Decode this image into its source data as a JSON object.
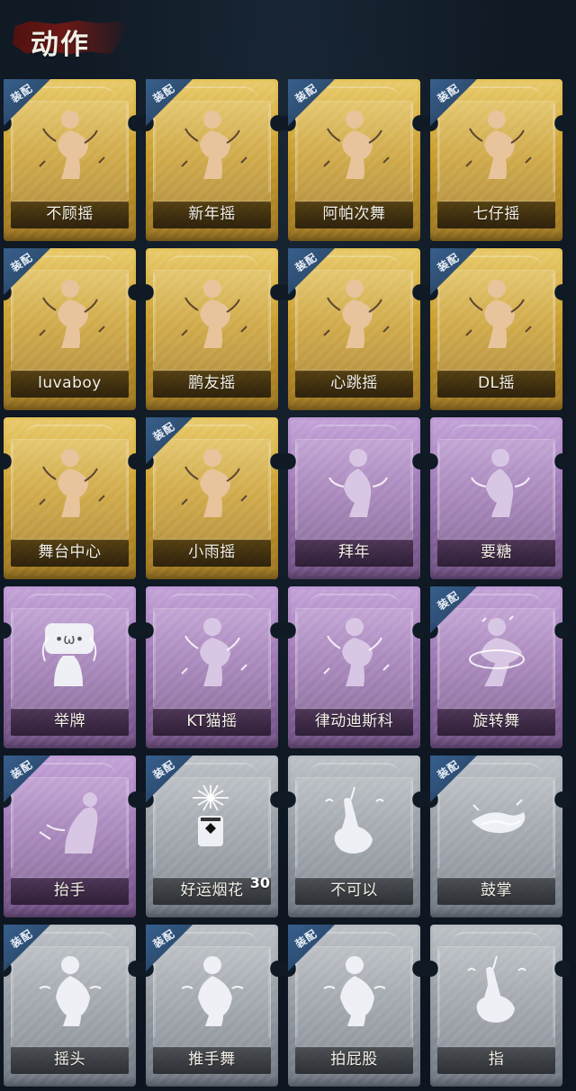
{
  "header": {
    "title": "动作"
  },
  "cards": [
    {
      "label": "不顾摇",
      "variant": "gold",
      "equipped": true,
      "icon": "dance-pose-icon"
    },
    {
      "label": "新年摇",
      "variant": "gold",
      "equipped": true,
      "icon": "dance-pose-icon"
    },
    {
      "label": "阿帕次舞",
      "variant": "gold",
      "equipped": true,
      "icon": "dance-pose-icon"
    },
    {
      "label": "七仔摇",
      "variant": "gold",
      "equipped": true,
      "icon": "dance-pose-icon"
    },
    {
      "label": "luvaboy",
      "variant": "gold",
      "equipped": true,
      "icon": "dance-pose-icon"
    },
    {
      "label": "鹏友摇",
      "variant": "gold",
      "equipped": false,
      "icon": "dance-pose-icon"
    },
    {
      "label": "心跳摇",
      "variant": "gold",
      "equipped": true,
      "icon": "dance-pose-icon"
    },
    {
      "label": "DL摇",
      "variant": "gold",
      "equipped": true,
      "icon": "dance-pose-icon"
    },
    {
      "label": "舞台中心",
      "variant": "gold",
      "equipped": false,
      "icon": "dance-pose-icon"
    },
    {
      "label": "小雨摇",
      "variant": "gold",
      "equipped": true,
      "icon": "dance-pose-icon"
    },
    {
      "label": "拜年",
      "variant": "purple",
      "equipped": false,
      "icon": "greeting-pose-icon"
    },
    {
      "label": "要糖",
      "variant": "purple",
      "equipped": false,
      "icon": "greeting-pose-icon"
    },
    {
      "label": "举牌",
      "variant": "purple",
      "equipped": false,
      "icon": "sign-pose-icon"
    },
    {
      "label": "KT猫摇",
      "variant": "purple",
      "equipped": false,
      "icon": "dance-pose-icon"
    },
    {
      "label": "律动迪斯科",
      "variant": "purple",
      "equipped": false,
      "icon": "dance-pose-icon"
    },
    {
      "label": "旋转舞",
      "variant": "purple",
      "equipped": true,
      "icon": "spin-pose-icon"
    },
    {
      "label": "抬手",
      "variant": "purple",
      "equipped": true,
      "icon": "raise-hand-icon"
    },
    {
      "label": "好运烟花",
      "variant": "gray",
      "equipped": true,
      "icon": "firework-can-icon",
      "count": "30"
    },
    {
      "label": "不可以",
      "variant": "gray",
      "equipped": false,
      "icon": "finger-wag-icon"
    },
    {
      "label": "鼓掌",
      "variant": "gray",
      "equipped": true,
      "icon": "clap-icon"
    },
    {
      "label": "摇头",
      "variant": "gray",
      "equipped": true,
      "icon": "head-shake-icon"
    },
    {
      "label": "推手舞",
      "variant": "gray",
      "equipped": true,
      "icon": "push-hands-icon"
    },
    {
      "label": "拍屁股",
      "variant": "gray",
      "equipped": true,
      "icon": "butt-slap-icon"
    },
    {
      "label": "指",
      "variant": "gray",
      "equipped": false,
      "icon": "point-icon"
    }
  ],
  "badge_text": "装配"
}
